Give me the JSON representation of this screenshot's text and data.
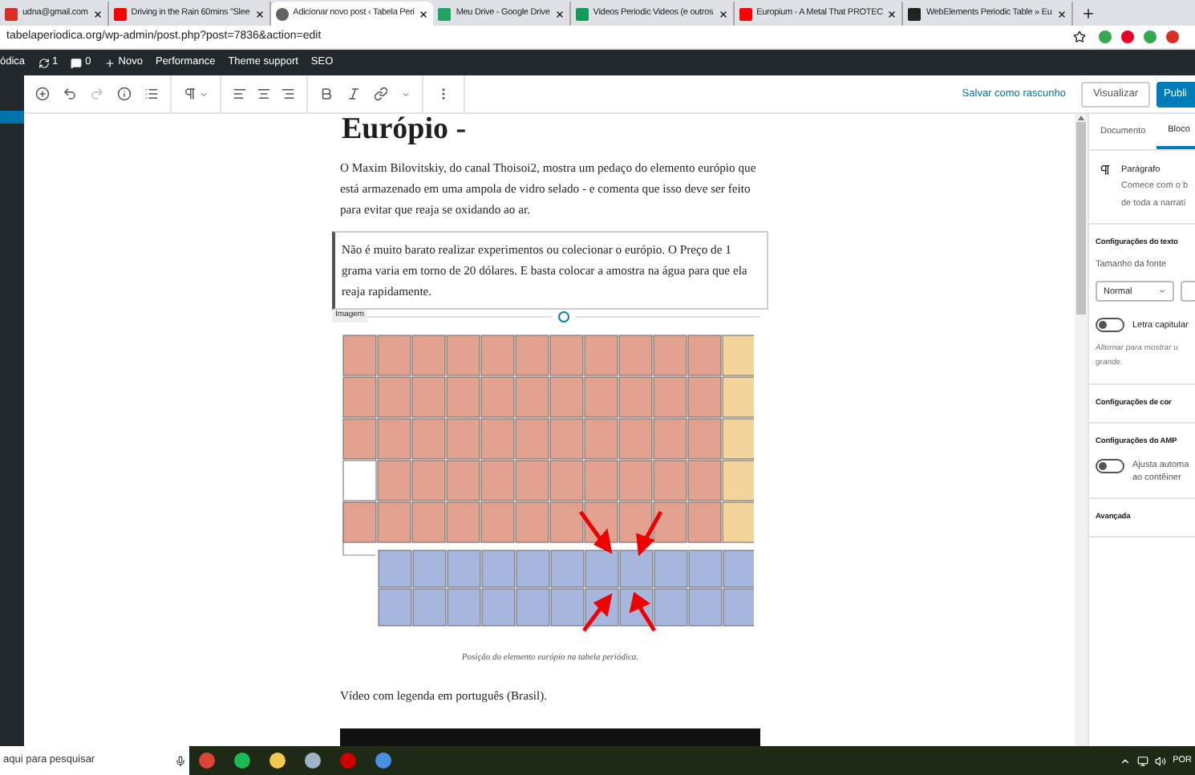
{
  "browser": {
    "tabs": [
      {
        "title": "udna@gmail.com",
        "kind": "mail",
        "selected": false
      },
      {
        "title": "Driving in the Rain 60mins \"Slee",
        "kind": "video",
        "selected": false
      },
      {
        "title": "Adicionar novo post ‹ Tabela Peri",
        "kind": "globe",
        "selected": true
      },
      {
        "title": "Meu Drive - Google Drive",
        "kind": "drive",
        "selected": false
      },
      {
        "title": "Videos Periodic Videos (e outros",
        "kind": "sheet",
        "selected": false
      },
      {
        "title": "Europium - A Metal That PROTEC",
        "kind": "video",
        "selected": false
      },
      {
        "title": "WebElements Periodic Table » Eu",
        "kind": "web",
        "selected": false
      }
    ],
    "address": "tabelaperiodica.org/wp-admin/post.php?post=7836&action=edit"
  },
  "admin_bar": {
    "site": "ódica",
    "updates": "1",
    "comments": "0",
    "new": "Novo",
    "items": [
      "Performance",
      "Theme support",
      "SEO"
    ]
  },
  "editor": {
    "save_draft": "Salvar como rascunho",
    "preview": "Visualizar",
    "publish": "Publi",
    "title": "Európio -",
    "paragraphs": [
      {
        "text": "O Maxim Bilovitskiy, do canal Thoisoi2, mostra um pedaço do elemento európio que está armazenado em uma ampola de vidro selado - e comenta que isso deve ser feito para evitar que reaja se oxidando ao ar.",
        "selected": false
      },
      {
        "text": "Não é muito barato realizar experimentos ou colecionar o európio. O Preço de 1 grama varia em torno de 20 dólares. E basta colocar a amostra na água para que ela reaja rapidamente.",
        "selected": true
      }
    ],
    "block_label": "Imagem",
    "caption": "Posição do elemento európio na tabela periódica.",
    "after_text": "Vídeo com legenda em português (Brasil)."
  },
  "sidebar": {
    "tabs": [
      {
        "label": "Documento",
        "selected": false
      },
      {
        "label": "Bloco",
        "selected": true
      }
    ],
    "block_name": "Parágrafo",
    "block_desc": [
      "Comece com o b",
      "de toda a narrati"
    ],
    "panels": [
      {
        "title": "Configurações do texto",
        "kind": "text"
      },
      {
        "title": "Configurações de cor",
        "kind": "plain"
      },
      {
        "title": "Configurações do AMP",
        "kind": "amp"
      },
      {
        "title": "Avançada",
        "kind": "plain"
      }
    ],
    "font_size_label": "Tamanho da fonte",
    "font_size": "Normal",
    "drop_cap": {
      "label": "Letra capitular",
      "on": false
    },
    "drop_cap_help": "Alternar para mostrar u grande.",
    "amp": {
      "label": "Ajusta automa ao contêiner",
      "on": false
    }
  },
  "taskbar": {
    "search_placeholder": "aqui para pesquisar",
    "lang": "POR"
  }
}
